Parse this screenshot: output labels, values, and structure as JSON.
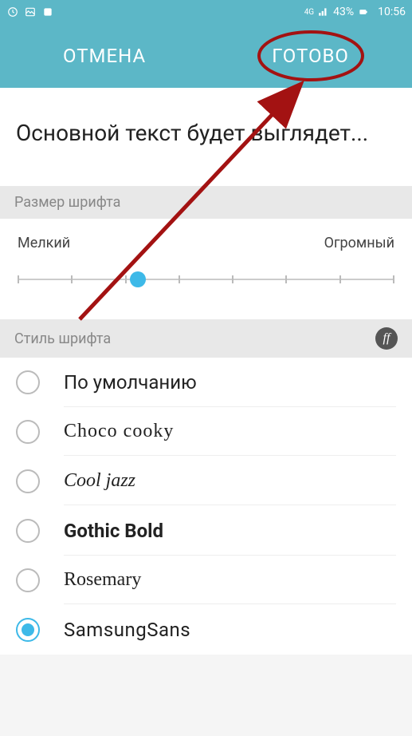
{
  "statusbar": {
    "network_label": "4G",
    "battery_text": "43%",
    "time": "10:56"
  },
  "actionbar": {
    "cancel_label": "ОТМЕНА",
    "done_label": "ГОТОВО"
  },
  "preview_text": "Основной текст будет выглядет...",
  "size_section": {
    "title": "Размер шрифта",
    "min_label": "Мелкий",
    "max_label": "Огромный"
  },
  "style_section": {
    "title": "Стиль шрифта",
    "ff_icon_glyph": "ff"
  },
  "fonts": [
    {
      "label": "По умолчанию",
      "class": "",
      "selected": false
    },
    {
      "label": "Choco cooky",
      "class": "f-choco",
      "selected": false
    },
    {
      "label": "Cool jazz",
      "class": "f-cooljazz",
      "selected": false
    },
    {
      "label": "Gothic Bold",
      "class": "f-gothic",
      "selected": false
    },
    {
      "label": "Rosemary",
      "class": "f-rosemary",
      "selected": false
    },
    {
      "label": "SamsungSans",
      "class": "f-samsung",
      "selected": true
    }
  ],
  "annotation": {
    "color": "#a31212"
  }
}
